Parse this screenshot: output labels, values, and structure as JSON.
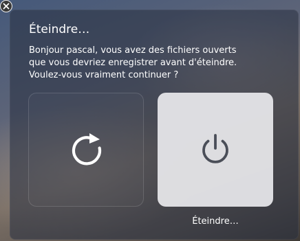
{
  "dialog": {
    "title": "Éteindre…",
    "message_lines": [
      "Bonjour pascal, vous avez des fichiers ouverts",
      "que vous devriez enregistrer avant d'éteindre.",
      "Voulez-vous vraiment continuer ?"
    ]
  },
  "close_icon": "close-icon",
  "actions": [
    {
      "id": "restart",
      "icon": "restart-icon",
      "label": ""
    },
    {
      "id": "shutdown",
      "icon": "power-icon",
      "label": "Éteindre…",
      "selected": true
    }
  ],
  "colors": {
    "text": "#ffffff",
    "selected_tile": "#e8e8ec",
    "power_glyph": "#4a4e58"
  }
}
